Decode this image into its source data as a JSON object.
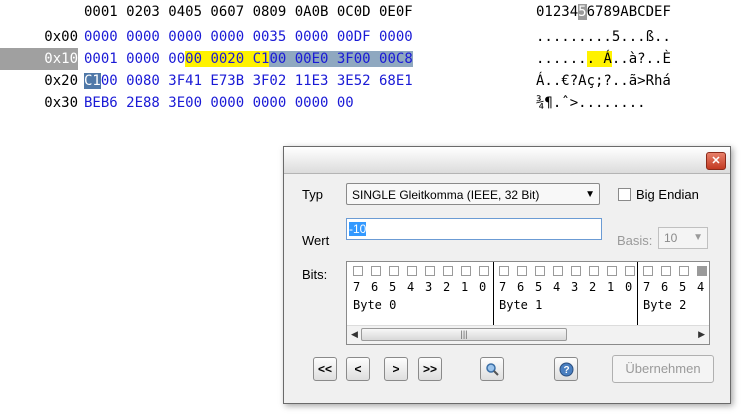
{
  "hex": {
    "header_hex": "0001 0203 0405 0607 0809 0A0B 0C0D 0E0F",
    "header_ascii_a": "01234",
    "header_ascii_cursor": "5",
    "header_ascii_b": "6789ABCDEF",
    "rows": [
      {
        "addr": "0x00",
        "hex": "0000 0000 0000 0000 0035 0000 00DF 0000",
        "ascii": ".........5...ß.."
      },
      {
        "addr": "0x10",
        "hex_a": "0001 0000 00",
        "hex_y": "00 0020 C1",
        "hex_b": "00 00E0 3F",
        "hex_b2": "00 00C8",
        "ascii_a": "......",
        "ascii_y": ". Á",
        "ascii_b": "..à?..È"
      },
      {
        "addr": "0x20",
        "hex_b2": "C1",
        "hex": "00 0080 3F41 E73B 3F02 11E3 3E52 68E1",
        "ascii": "Á..€?Aç;?..ã>Rhá"
      },
      {
        "addr": "0x30",
        "hex": "BEB6 2E88 3E00 0000 0000 0000 00",
        "ascii": "¾¶.ˆ>........"
      }
    ]
  },
  "dialog": {
    "close_icon": "close-x-icon",
    "type_label": "Typ",
    "type_value": "SINGLE Gleitkomma (IEEE, 32 Bit)",
    "big_endian_label": "Big Endian",
    "value_label": "Wert",
    "value": "-10",
    "basis_label": "Basis:",
    "basis_value": "10",
    "bits_label": "Bits:",
    "bit_numbers": [
      "7",
      "6",
      "5",
      "4",
      "3",
      "2",
      "1",
      "0"
    ],
    "byte_labels": [
      "Byte 0",
      "Byte 1",
      "Byte 2"
    ],
    "nav": {
      "first": "<<",
      "prev": "<",
      "next": ">",
      "last": ">>"
    },
    "apply_label": "Übernehmen"
  }
}
